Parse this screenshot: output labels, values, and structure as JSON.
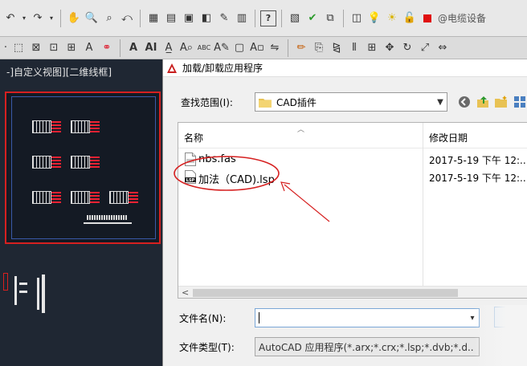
{
  "toolbar": {
    "layer_name": "@电缆设备"
  },
  "viewport": {
    "label": "-]自定义视图][二维线框]"
  },
  "dialog": {
    "title": "加载/卸载应用程序",
    "look_in_label": "查找范围(I):",
    "look_in_value": "CAD插件",
    "columns": {
      "name": "名称",
      "modified": "修改日期"
    },
    "files": [
      {
        "name": "nbs.fas",
        "modified": "2017-5-19 下午 12:..",
        "icon": "fas-file-icon"
      },
      {
        "name": "加法（CAD).lsp",
        "modified": "2017-5-19 下午 12:..",
        "icon": "lsp-file-icon"
      }
    ],
    "filename_label": "文件名(N):",
    "filename_value": "",
    "filetype_label": "文件类型(T):",
    "filetype_value": "AutoCAD 应用程序(*.arx;*.crx;*.lsp;*.dvb;*.d.."
  },
  "colors": {
    "annotation": "#d62020",
    "cad_background": "#1f2733",
    "dialog_background": "#f0f0f0"
  }
}
